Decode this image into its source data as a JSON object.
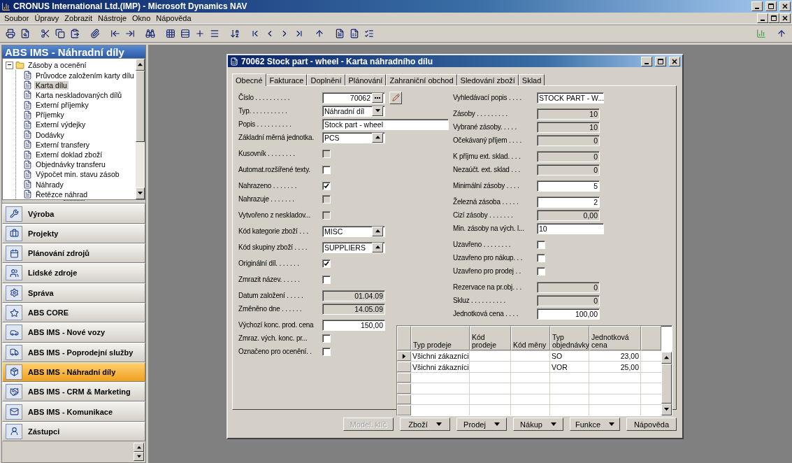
{
  "app": {
    "title": "CRONUS International Ltd.(IMP) - Microsoft Dynamics NAV"
  },
  "menu": [
    "Soubor",
    "Úpravy",
    "Zobrazit",
    "Nástroje",
    "Okno",
    "Nápověda"
  ],
  "nav": {
    "title": "ABS IMS - Náhradní díly",
    "tree": [
      {
        "label": "Zásoby a ocenění",
        "expanded": true,
        "selected": false,
        "children": [
          {
            "label": "Průvodce založením karty dílu",
            "selected": false
          },
          {
            "label": "Karta dílu",
            "selected": true
          },
          {
            "label": "Karta neskladovaných dílů",
            "selected": false
          },
          {
            "label": "Externí příjemky",
            "selected": false
          },
          {
            "label": "Příjemky",
            "selected": false
          },
          {
            "label": "Externí výdejky",
            "selected": false
          },
          {
            "label": "Dodávky",
            "selected": false
          },
          {
            "label": "Externí transfery",
            "selected": false
          },
          {
            "label": "Externí doklad zboží",
            "selected": false
          },
          {
            "label": "Objednávky transferu",
            "selected": false
          },
          {
            "label": "Výpočet min. stavu zásob",
            "selected": false
          },
          {
            "label": "Náhrady",
            "selected": false
          },
          {
            "label": "Řetězce náhrad",
            "selected": false
          }
        ]
      }
    ],
    "modules": [
      {
        "label": "Výroba",
        "selected": false
      },
      {
        "label": "Projekty",
        "selected": false
      },
      {
        "label": "Plánování zdrojů",
        "selected": false
      },
      {
        "label": "Lidské zdroje",
        "selected": false
      },
      {
        "label": "Správa",
        "selected": false
      },
      {
        "label": "ABS CORE",
        "selected": false
      },
      {
        "label": "ABS IMS - Nové vozy",
        "selected": false
      },
      {
        "label": "ABS IMS - Poprodejní služby",
        "selected": false
      },
      {
        "label": "ABS IMS - Náhradní díly",
        "selected": true
      },
      {
        "label": "ABS IMS - CRM & Marketing",
        "selected": false
      },
      {
        "label": "ABS IMS - Komunikace",
        "selected": false
      },
      {
        "label": "Zástupci",
        "selected": false
      }
    ]
  },
  "card": {
    "title": "70062 Stock part - wheel - Karta náhradního dílu",
    "tabs": [
      {
        "label": "Obecné",
        "selected": true
      },
      {
        "label": "Fakturace",
        "selected": false
      },
      {
        "label": "Doplnění",
        "selected": false
      },
      {
        "label": "Plánování",
        "selected": false
      },
      {
        "label": "Zahraniční obchod",
        "selected": false
      },
      {
        "label": "Sledování zboží",
        "selected": false
      },
      {
        "label": "Sklad",
        "selected": false
      }
    ],
    "columns": [
      [
        [
          {
            "label": "Číslo . . . . . . . . . .",
            "kind": "assist",
            "value": "70062"
          },
          {
            "label": "Typ. . . . . . . . . . .",
            "kind": "dropdown",
            "value": "Náhradní díl"
          },
          {
            "label": "Popis . . . . . . . . . .",
            "kind": "text",
            "value": "Stock part - wheel"
          },
          {
            "label": "Základní měrná jednotka.",
            "kind": "lookup",
            "value": "PCS"
          }
        ],
        [
          {
            "label": "Kusovník . . . . . . . .",
            "kind": "checkbox",
            "checked": false,
            "disabled": true
          }
        ],
        [
          {
            "label": "Automat.rozšířené texty.",
            "kind": "checkbox",
            "checked": false,
            "disabled": false
          }
        ],
        [
          {
            "label": "Nahrazeno . . . . . . .",
            "kind": "checkbox",
            "checked": true,
            "disabled": false
          },
          {
            "label": "Nahrazuje . . . . . . .",
            "kind": "checkbox",
            "checked": false,
            "disabled": true
          }
        ],
        [
          {
            "label": "Vytvořeno z neskladov...",
            "kind": "checkbox",
            "checked": false,
            "disabled": true
          }
        ],
        [
          {
            "label": "Kód kategorie zboží . . .",
            "kind": "lookup",
            "value": "MISC"
          }
        ],
        [
          {
            "label": "Kód skupiny zboží . . . .",
            "kind": "lookup",
            "value": "SUPPLIERS"
          }
        ],
        [
          {
            "label": "Originální díl. . . . . . .",
            "kind": "checkbox",
            "checked": true,
            "disabled": false
          }
        ],
        [
          {
            "label": "Zmrazit název. . . . . .",
            "kind": "checkbox",
            "checked": false,
            "disabled": false
          }
        ],
        [
          {
            "label": "Datum založení . . . . .",
            "kind": "readonly",
            "value": "01.04.09"
          },
          {
            "label": "Změněno dne . . . . . .",
            "kind": "readonly",
            "value": "14.05.09"
          }
        ],
        [
          {
            "label": "Výchozí konc. prod. cena",
            "kind": "number",
            "value": "150,00"
          },
          {
            "label": "Zmraz. vých. konc. pr...",
            "kind": "checkbox",
            "checked": false,
            "disabled": false
          },
          {
            "label": "Označeno pro ocenění. .",
            "kind": "checkbox",
            "checked": false,
            "disabled": false
          }
        ]
      ],
      [
        [
          {
            "label": "Vyhledávací popis . . . .",
            "kind": "text",
            "value": "STOCK PART - W..."
          }
        ],
        [
          {
            "label": "Zásoby . . . . . . . . .",
            "kind": "readonly",
            "value": "10"
          },
          {
            "label": "Vybrané zásoby. . . . .",
            "kind": "readonly",
            "value": "10"
          },
          {
            "label": "Očekávaný příjem . . . .",
            "kind": "readonly",
            "value": "0"
          }
        ],
        [
          {
            "label": "K příjmu ext. sklad. . . .",
            "kind": "readonly",
            "value": "0"
          },
          {
            "label": "Nezaúčt. ext. sklad . . .",
            "kind": "readonly",
            "value": "0"
          }
        ],
        [
          {
            "label": "Minimální zásoby . . . .",
            "kind": "number",
            "value": "5"
          }
        ],
        [
          {
            "label": "Železná zásoba . . . . .",
            "kind": "number",
            "value": "2"
          },
          {
            "label": "Cizí zásoby . . . . . . .",
            "kind": "readonly",
            "value": "0,00"
          },
          {
            "label": "Min. zásoby na vých. l...",
            "kind": "text",
            "value": "10"
          }
        ],
        [
          {
            "label": "Uzavřeno . . . . . . . .",
            "kind": "checkbox",
            "checked": false,
            "disabled": false
          },
          {
            "label": "Uzavřeno pro nákup. . .",
            "kind": "checkbox",
            "checked": false,
            "disabled": false
          },
          {
            "label": "Uzavřeno pro prodej . .",
            "kind": "checkbox",
            "checked": false,
            "disabled": false
          }
        ],
        [
          {
            "label": "Rezervace na pr.obj. . .",
            "kind": "readonly",
            "value": "0"
          },
          {
            "label": "Skluz . . . . . . . . . .",
            "kind": "readonly",
            "value": "0"
          },
          {
            "label": "Jednotková cena . . . .",
            "kind": "number",
            "value": "100,00"
          }
        ]
      ]
    ],
    "grid": {
      "columns": [
        {
          "label": "Typ prodeje",
          "kind": "text"
        },
        {
          "label": "Kód prodeje",
          "kind": "text"
        },
        {
          "label": "Kód měny",
          "kind": "text"
        },
        {
          "label": "Typ objednávky",
          "kind": "text"
        },
        {
          "label": "Jednotková cena",
          "kind": "number"
        }
      ],
      "rows": [
        {
          "selected": true,
          "cells": [
            "Všichni zákazníci",
            null,
            null,
            "SO",
            "23,00"
          ]
        },
        {
          "selected": false,
          "cells": [
            "Všichni zákazníci",
            null,
            null,
            "VOR",
            "25,00"
          ]
        }
      ]
    },
    "buttons": [
      {
        "label": "Model. klíč",
        "disabled": true,
        "menu": false
      },
      {
        "label": "Zboží",
        "disabled": false,
        "menu": true
      },
      {
        "label": "Prodej",
        "disabled": false,
        "menu": true
      },
      {
        "label": "Nákup",
        "disabled": false,
        "menu": true
      },
      {
        "label": "Funkce",
        "disabled": false,
        "menu": true
      },
      {
        "label": "Nápověda",
        "disabled": false,
        "menu": false
      }
    ]
  }
}
